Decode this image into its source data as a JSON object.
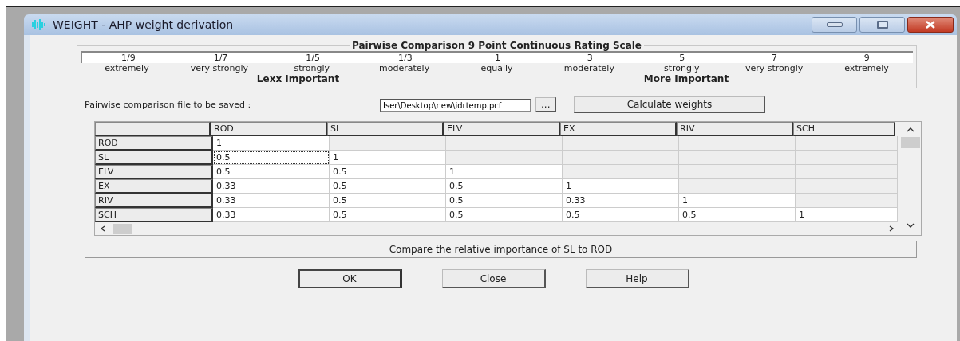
{
  "window": {
    "title": "WEIGHT - AHP weight derivation"
  },
  "scale": {
    "title": "Pairwise Comparison 9 Point Continuous Rating Scale",
    "points": [
      {
        "value": "1/9",
        "label": "extremely"
      },
      {
        "value": "1/7",
        "label": "very strongly"
      },
      {
        "value": "1/5",
        "label": "strongly"
      },
      {
        "value": "1/3",
        "label": "moderately"
      },
      {
        "value": "1",
        "label": "equally"
      },
      {
        "value": "3",
        "label": "moderately"
      },
      {
        "value": "5",
        "label": "strongly"
      },
      {
        "value": "7",
        "label": "very strongly"
      },
      {
        "value": "9",
        "label": "extremely"
      }
    ],
    "less_label": "Lexx Important",
    "more_label": "More Important"
  },
  "file": {
    "label": "Pairwise comparison file to be saved :",
    "value": "Iser\\Desktop\\new\\idrtemp.pcf",
    "browse_button": "...",
    "calculate_button": "Calculate weights"
  },
  "table": {
    "columns": [
      "ROD",
      "SL",
      "ELV",
      "EX",
      "RIV",
      "SCH"
    ],
    "rows": [
      {
        "name": "ROD",
        "cells": [
          {
            "value": "1",
            "focused": false
          }
        ]
      },
      {
        "name": "SL",
        "cells": [
          {
            "value": "0.5",
            "focused": true
          },
          {
            "value": "1",
            "focused": false
          }
        ]
      },
      {
        "name": "ELV",
        "cells": [
          {
            "value": "0.5",
            "focused": false
          },
          {
            "value": "0.5",
            "focused": false
          },
          {
            "value": "1",
            "focused": false
          }
        ]
      },
      {
        "name": "EX",
        "cells": [
          {
            "value": "0.33",
            "focused": false
          },
          {
            "value": "0.5",
            "focused": false
          },
          {
            "value": "0.5",
            "focused": false
          },
          {
            "value": "1",
            "focused": false
          }
        ]
      },
      {
        "name": "RIV",
        "cells": [
          {
            "value": "0.33",
            "focused": false
          },
          {
            "value": "0.5",
            "focused": false
          },
          {
            "value": "0.5",
            "focused": false
          },
          {
            "value": "0.33",
            "focused": false
          },
          {
            "value": "1",
            "focused": false
          }
        ]
      },
      {
        "name": "SCH",
        "cells": [
          {
            "value": "0.33",
            "focused": false
          },
          {
            "value": "0.5",
            "focused": false
          },
          {
            "value": "0.5",
            "focused": false
          },
          {
            "value": "0.5",
            "focused": false
          },
          {
            "value": "0.5",
            "focused": false
          },
          {
            "value": "1",
            "focused": false
          }
        ]
      }
    ]
  },
  "status": "Compare the relative importance of SL to ROD",
  "buttons": [
    "OK",
    "Close",
    "Help"
  ]
}
